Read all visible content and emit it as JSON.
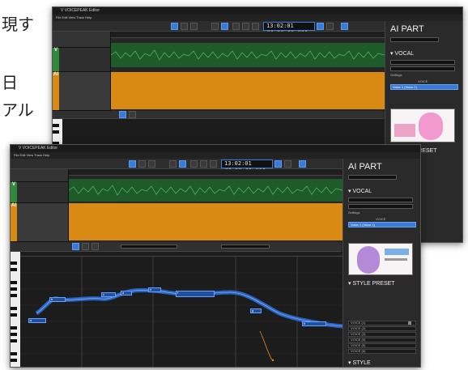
{
  "caption_lines": [
    "現す",
    "日",
    "アル"
  ],
  "back_window": {
    "title": "V  VOICEPEAK Editor",
    "menu": "File  Edit  View  Track  Help",
    "timecode": "13:02:01 ##.##.## ###",
    "panel_title": "AI PART",
    "section_vocal": "▾ VOCAL",
    "section_style_preset": "▾ STYLE PRESET",
    "voice_label": "VOICE",
    "row_label": "Settings",
    "selected_voice": "Voice 1 (Voice 1)"
  },
  "front_window": {
    "title": "V  VOICEPEAK Editor",
    "menu": "File  Edit  View  Track  Help",
    "timecode": "13:02:01 ##.##.## ###",
    "panel_title": "AI PART",
    "section_vocal": "▾ VOCAL",
    "section_style_preset": "▾ STYLE PRESET",
    "section_style": "▾ STYLE",
    "voice_label": "VOICE",
    "row_label": "Settings",
    "selected_voice": "Voice 1 (Voice 1)",
    "style_params": [
      "VOICE (1)",
      "VOICE (2)",
      "VOICE (3)",
      "VOICE (4)",
      "VOICE (5)",
      "VOICE (6)",
      "VOICE (7)",
      "VOICE (8)"
    ],
    "note_labels": [
      "a",
      "b",
      "c",
      "d",
      "e",
      "f",
      "g",
      "h"
    ]
  },
  "colors": {
    "accent": "#3a7bd5",
    "track_orange": "#d98a12",
    "track_green": "#1f5a2a",
    "note_blue": "#1f4f9f"
  }
}
